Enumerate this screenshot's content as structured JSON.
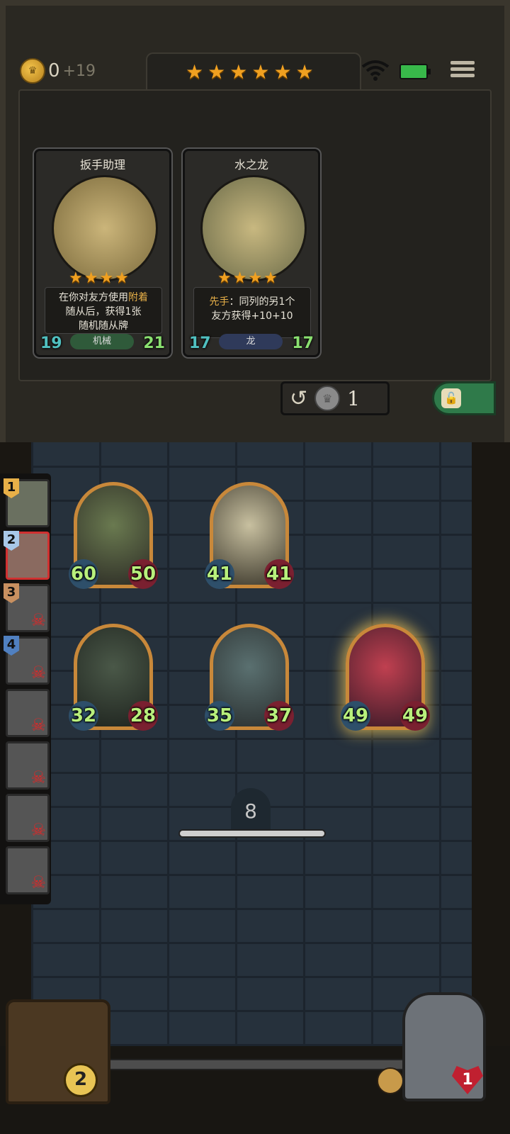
{
  "header": {
    "gold_amount": "0",
    "gold_increment": "+19",
    "tavern_star_count": 6,
    "icons": [
      "coin-icon",
      "wifi-icon",
      "battery-icon",
      "menu-icon"
    ]
  },
  "shop": {
    "cards": [
      {
        "name": "扳手助理",
        "stars": 4,
        "desc_line1_pre": "在你对友方使用",
        "desc_line1_kw": "附着",
        "desc_line2": "随从后，获得1张",
        "desc_line3": "随机随从牌",
        "attack": "19",
        "health": "21",
        "tribe": "机械",
        "tribe_color": "#2f5a3a"
      },
      {
        "name": "水之龙",
        "stars": 4,
        "desc_line1_kw": "先手",
        "desc_line1_post": "：同列的另1个",
        "desc_line2": "友方获得+10+10",
        "attack": "17",
        "health": "17",
        "tribe": "龙",
        "tribe_color": "#2f3a5a"
      }
    ],
    "refresh_cost": "1",
    "lock_state": "unlocked"
  },
  "players": [
    {
      "rank": "1",
      "eliminated": false,
      "rank_color": "#e8b048"
    },
    {
      "rank": "2",
      "eliminated": false,
      "rank_color": "#8ab0d0",
      "current": true
    },
    {
      "rank": "3",
      "eliminated": true,
      "rank_color": "#c89060"
    },
    {
      "rank": "4",
      "eliminated": true,
      "rank_color": "#5080c0"
    },
    {
      "rank": "",
      "eliminated": true
    },
    {
      "rank": "",
      "eliminated": true
    },
    {
      "rank": "",
      "eliminated": true
    },
    {
      "rank": "",
      "eliminated": true
    }
  ],
  "board": {
    "minions": [
      {
        "attack": "60",
        "health": "50",
        "golden": false
      },
      {
        "attack": "41",
        "health": "41",
        "golden": false
      },
      {
        "attack": "32",
        "health": "28",
        "golden": false
      },
      {
        "attack": "35",
        "health": "37",
        "golden": false
      },
      {
        "attack": "49",
        "health": "49",
        "golden": true
      }
    ],
    "timer": "8"
  },
  "bottom": {
    "deck_count": "2",
    "hero_health": "1"
  }
}
